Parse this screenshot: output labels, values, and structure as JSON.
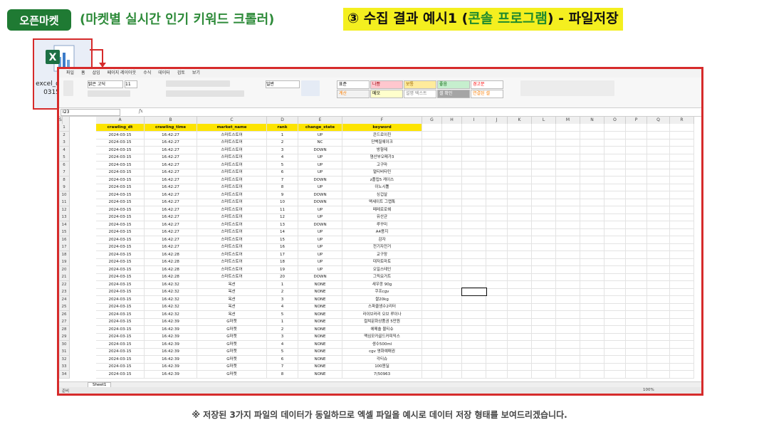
{
  "header": {
    "tag": "오픈마켓",
    "subtitle": "(마켓별 실시간 인기 키워드 크롤러)",
    "headline_prefix": "③ 수집 결과 예시1 (",
    "headline_green": "콘솔 프로그램",
    "headline_suffix": ") - 파일저장"
  },
  "file_icon": {
    "name": "excel_data_20240315_1.xlsx"
  },
  "excel": {
    "ribbon_tabs": [
      "파일",
      "홈",
      "삽입",
      "페이지 레이아웃",
      "수식",
      "데이터",
      "검토",
      "보기"
    ],
    "styles": [
      {
        "label": "표준",
        "bg": "#ffffff",
        "color": "#000000"
      },
      {
        "label": "나쁨",
        "bg": "#ffc7ce",
        "color": "#9c0006"
      },
      {
        "label": "보통",
        "bg": "#ffeb9c",
        "color": "#9c6500"
      },
      {
        "label": "좋음",
        "bg": "#c6efce",
        "color": "#006100"
      },
      {
        "label": "경고문",
        "bg": "#ffffff",
        "color": "#ff0000"
      },
      {
        "label": "계산",
        "bg": "#f2f2f2",
        "color": "#fa7d00"
      },
      {
        "label": "메모",
        "bg": "#ffffcc",
        "color": "#000000"
      },
      {
        "label": "설명 텍스트",
        "bg": "#ffffff",
        "color": "#7f7f7f"
      },
      {
        "label": "셀 확인",
        "bg": "#a5a5a5",
        "color": "#ffffff"
      },
      {
        "label": "연결된 셀",
        "bg": "#ffffff",
        "color": "#fa7d00"
      }
    ],
    "font_name": "맑은 고딕",
    "font_size": "11",
    "number_format": "일반",
    "name_box": "I23",
    "fx": "fx",
    "column_letters": [
      "A",
      "B",
      "C",
      "D",
      "E",
      "F",
      "G",
      "H",
      "I",
      "J",
      "K",
      "L",
      "M",
      "N",
      "O",
      "P",
      "Q",
      "R",
      "S"
    ],
    "columns": [
      "crawling_dt",
      "crawling_time",
      "market_name",
      "rank",
      "change_state",
      "keyword"
    ],
    "rows": [
      [
        "2024-03-15",
        "16:42:27",
        "스마트스토어",
        "1",
        "UP",
        "콘드로이친"
      ],
      [
        "2024-03-15",
        "16:42:27",
        "스마트스토어",
        "2",
        "NC",
        "단백질쉐이크"
      ],
      [
        "2024-03-15",
        "16:42:27",
        "스마트스토어",
        "3",
        "DOWN",
        "방향제"
      ],
      [
        "2024-03-15",
        "16:42:27",
        "스마트스토어",
        "4",
        "UP",
        "염산부오메가3"
      ],
      [
        "2024-03-15",
        "16:42:27",
        "스마트스토어",
        "5",
        "UP",
        "고구마"
      ],
      [
        "2024-03-15",
        "16:42:27",
        "스마트스토어",
        "6",
        "UP",
        "멀티비타민"
      ],
      [
        "2024-03-15",
        "16:42:27",
        "스마트스토어",
        "7",
        "DOWN",
        "z플립5 케이스"
      ],
      [
        "2024-03-15",
        "16:42:27",
        "스마트스토어",
        "8",
        "UP",
        "이노시톨"
      ],
      [
        "2024-03-15",
        "16:42:27",
        "스마트스토어",
        "9",
        "DOWN",
        "싱겁살"
      ],
      [
        "2024-03-15",
        "16:42:27",
        "스마트스토어",
        "10",
        "DOWN",
        "액세이트 그랩톡"
      ],
      [
        "2024-03-15",
        "16:42:27",
        "스마트스토어",
        "11",
        "UP",
        "페레로로쉐"
      ],
      [
        "2024-03-15",
        "16:42:27",
        "스마트스토어",
        "12",
        "UP",
        "유산균"
      ],
      [
        "2024-03-15",
        "16:42:27",
        "스마트스토어",
        "13",
        "DOWN",
        "루꾸미"
      ],
      [
        "2024-03-15",
        "16:42:27",
        "스마트스토어",
        "14",
        "UP",
        "A4용지"
      ],
      [
        "2024-03-15",
        "16:42:27",
        "스마트스토어",
        "15",
        "UP",
        "감자"
      ],
      [
        "2024-03-15",
        "16:42:27",
        "스마트스토어",
        "16",
        "UP",
        "전기자전거"
      ],
      [
        "2024-03-15",
        "16:42:28",
        "스마트스토어",
        "17",
        "UP",
        "교구장"
      ],
      [
        "2024-03-15",
        "16:42:28",
        "스마트스토어",
        "18",
        "UP",
        "대저토마토"
      ],
      [
        "2024-03-15",
        "16:42:28",
        "스마트스토어",
        "19",
        "UP",
        "오일스테인"
      ],
      [
        "2024-03-15",
        "16:42:28",
        "스마트스토어",
        "20",
        "DOWN",
        "그릭요거트"
      ],
      [
        "2024-03-15",
        "16:42:32",
        "옥션",
        "1",
        "NONE",
        "새우깡 90g"
      ],
      [
        "2024-03-15",
        "16:42:32",
        "옥션",
        "2",
        "NONE",
        "쿠프cgv"
      ],
      [
        "2024-03-15",
        "16:42:32",
        "옥션",
        "3",
        "NONE",
        "쌀20kg"
      ],
      [
        "2024-03-15",
        "16:42:32",
        "옥션",
        "4",
        "NONE",
        "스파클생수2리터"
      ],
      [
        "2024-03-15",
        "16:42:32",
        "옥션",
        "5",
        "NONE",
        "라이브러리 오브 루이나"
      ],
      [
        "2024-03-15",
        "16:42:39",
        "G마켓",
        "1",
        "NONE",
        "컬쳐문화상품권 5만원"
      ],
      [
        "2024-03-15",
        "16:42:39",
        "G마켓",
        "2",
        "NONE",
        "에메솔 물티슈"
      ],
      [
        "2024-03-15",
        "16:42:39",
        "G마켓",
        "3",
        "NONE",
        "맥심모카골드커피믹스"
      ],
      [
        "2024-03-15",
        "16:42:39",
        "G마켓",
        "4",
        "NONE",
        "생수500ml"
      ],
      [
        "2024-03-15",
        "16:42:39",
        "G마켓",
        "5",
        "NONE",
        "cgv 영화예매권"
      ],
      [
        "2024-03-15",
        "16:42:39",
        "G마켓",
        "6",
        "NONE",
        "각티슈"
      ],
      [
        "2024-03-15",
        "16:42:39",
        "G마켓",
        "7",
        "NONE",
        "100원딜"
      ],
      [
        "2024-03-15",
        "16:42:39",
        "G마켓",
        "8",
        "NONE",
        "7(50963"
      ]
    ],
    "sheet_tab": "Sheet1",
    "status_left": "준비",
    "zoom": "100%"
  },
  "footnote": "※ 저장된 3가지 파일의 데이터가 동일하므로 엑셀 파일을 예시로 데이터 저장 형태를 보여드리겠습니다.",
  "colors": {
    "accent_red": "#d62b2b",
    "header_yellow": "#fde400",
    "tag_green": "#1f7a33"
  }
}
